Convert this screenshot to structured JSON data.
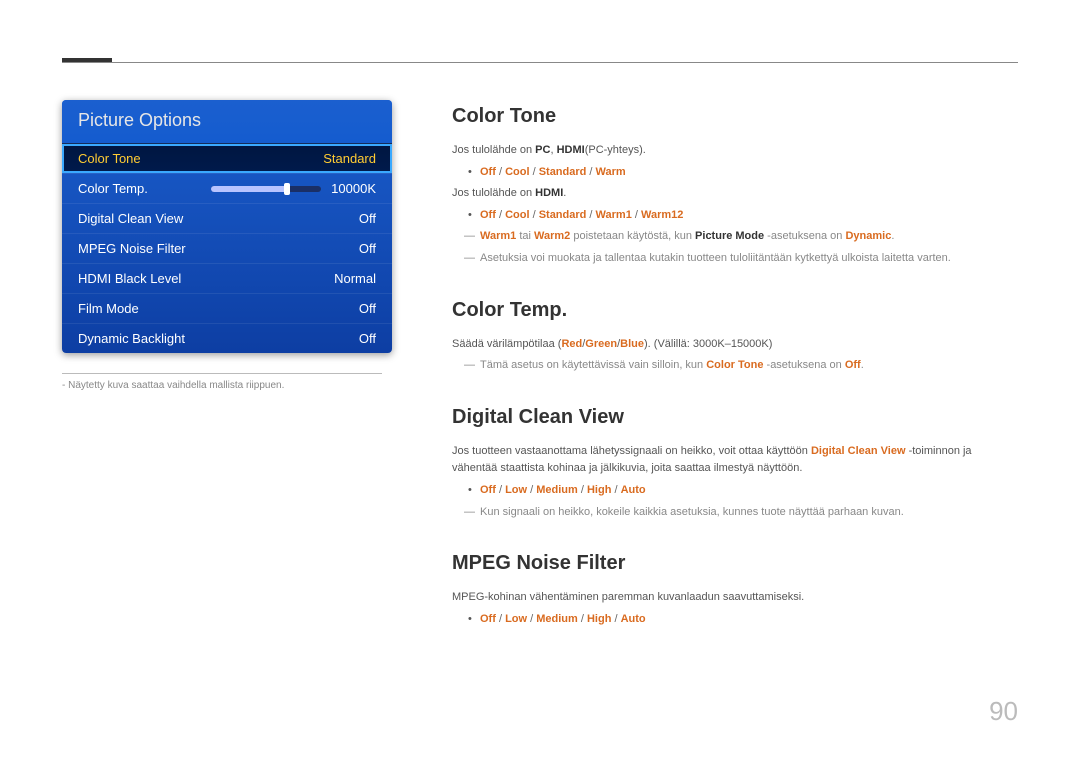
{
  "page_number": "90",
  "osd": {
    "title": "Picture Options",
    "rows": [
      {
        "label": "Color Tone",
        "value": "Standard",
        "selected": true
      },
      {
        "label": "Color Temp.",
        "value": "10000K",
        "slider": true
      },
      {
        "label": "Digital Clean View",
        "value": "Off"
      },
      {
        "label": "MPEG Noise Filter",
        "value": "Off"
      },
      {
        "label": "HDMI Black Level",
        "value": "Normal"
      },
      {
        "label": "Film Mode",
        "value": "Off"
      },
      {
        "label": "Dynamic Backlight",
        "value": "Off"
      }
    ],
    "footnote_prefix": "-",
    "footnote": "Näytetty kuva saattaa vaihdella mallista riippuen."
  },
  "sections": {
    "color_tone": {
      "title": "Color Tone",
      "line1_a": "Jos tulolähde on ",
      "line1_b": "PC",
      "line1_c": ", ",
      "line1_d": "HDMI",
      "line1_e": "(PC-yhteys).",
      "opts1": {
        "o1": "Off",
        "o2": "Cool",
        "o3": "Standard",
        "o4": "Warm"
      },
      "line2_a": "Jos tulolähde on ",
      "line2_b": "HDMI",
      "line2_c": ".",
      "opts2": {
        "o1": "Off",
        "o2": "Cool",
        "o3": "Standard",
        "o4": "Warm1",
        "o5": "Warm12"
      },
      "note1_a": "Warm1",
      "note1_b": " tai ",
      "note1_c": "Warm2",
      "note1_d": " poistetaan käytöstä, kun ",
      "note1_e": "Picture Mode",
      "note1_f": " -asetuksena on ",
      "note1_g": "Dynamic",
      "note1_h": ".",
      "note2": "Asetuksia voi muokata ja tallentaa kutakin tuotteen tuloliitäntään kytkettyä ulkoista laitetta varten."
    },
    "color_temp": {
      "title": "Color Temp.",
      "line1_a": "Säädä värilämpötilaa (",
      "line1_r": "Red",
      "line1_s1": "/",
      "line1_g": "Green",
      "line1_s2": "/",
      "line1_b": "Blue",
      "line1_c": "). (Välillä: 3000K–15000K)",
      "note_a": "Tämä asetus on käytettävissä vain silloin, kun ",
      "note_b": "Color Tone",
      "note_c": " -asetuksena on ",
      "note_d": "Off",
      "note_e": "."
    },
    "dcv": {
      "title": "Digital Clean View",
      "line1_a": "Jos tuotteen vastaanottama lähetyssignaali on heikko, voit ottaa käyttöön ",
      "line1_b": "Digital Clean View",
      "line1_c": " -toiminnon ja vähentää staattista kohinaa ja jälkikuvia, joita saattaa ilmestyä näyttöön.",
      "opts": {
        "o1": "Off",
        "o2": "Low",
        "o3": "Medium",
        "o4": "High",
        "o5": "Auto"
      },
      "note": "Kun signaali on heikko, kokeile kaikkia asetuksia, kunnes tuote näyttää parhaan kuvan."
    },
    "mpeg": {
      "title": "MPEG Noise Filter",
      "line1": "MPEG-kohinan vähentäminen paremman kuvanlaadun saavuttamiseksi.",
      "opts": {
        "o1": "Off",
        "o2": "Low",
        "o3": "Medium",
        "o4": "High",
        "o5": "Auto"
      }
    },
    "sep": " / "
  }
}
